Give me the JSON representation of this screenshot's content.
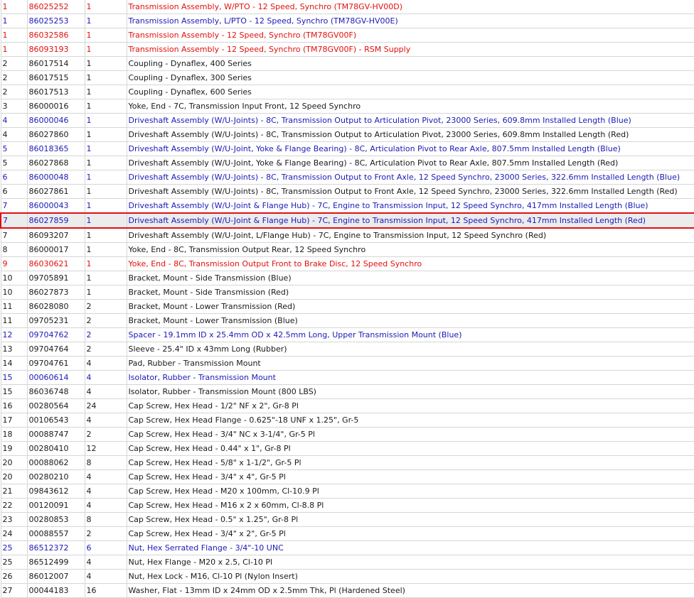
{
  "colors": {
    "red": "#e0100d",
    "blue": "#1a1ab8",
    "black": "#1a1a1a",
    "highlight_border": "#e01014",
    "grid": "#d6d6d6"
  },
  "rows": [
    {
      "item": "1",
      "part": "86025252",
      "qty": "1",
      "desc": "Transmission Assembly, W/PTO - 12 Speed, Synchro (TM78GV-HV00D)",
      "color": "red",
      "highlighted": false
    },
    {
      "item": "1",
      "part": "86025253",
      "qty": "1",
      "desc": "Transmission Assembly, L/PTO - 12 Speed, Synchro (TM78GV-HV00E)",
      "color": "blue",
      "highlighted": false
    },
    {
      "item": "1",
      "part": "86032586",
      "qty": "1",
      "desc": "Transmission Assembly - 12 Speed, Synchro (TM78GV00F)",
      "color": "red",
      "highlighted": false
    },
    {
      "item": "1",
      "part": "86093193",
      "qty": "1",
      "desc": "Transmission Assembly - 12 Speed, Synchro (TM78GV00F) - RSM Supply",
      "color": "red",
      "highlighted": false
    },
    {
      "item": "2",
      "part": "86017514",
      "qty": "1",
      "desc": "Coupling - Dynaflex, 400 Series",
      "color": "black",
      "highlighted": false
    },
    {
      "item": "2",
      "part": "86017515",
      "qty": "1",
      "desc": "Coupling - Dynaflex, 300 Series",
      "color": "black",
      "highlighted": false
    },
    {
      "item": "2",
      "part": "86017513",
      "qty": "1",
      "desc": "Coupling - Dynaflex, 600 Series",
      "color": "black",
      "highlighted": false
    },
    {
      "item": "3",
      "part": "86000016",
      "qty": "1",
      "desc": "Yoke, End - 7C, Transmission Input Front, 12 Speed Synchro",
      "color": "black",
      "highlighted": false
    },
    {
      "item": "4",
      "part": "86000046",
      "qty": "1",
      "desc": "Driveshaft Assembly (W/U-Joints) - 8C, Transmission Output to Articulation Pivot, 23000 Series, 609.8mm Installed Length (Blue)",
      "color": "blue",
      "highlighted": false
    },
    {
      "item": "4",
      "part": "86027860",
      "qty": "1",
      "desc": "Driveshaft Assembly (W/U-Joints) - 8C, Transmission Output to Articulation Pivot, 23000 Series, 609.8mm Installed Length (Red)",
      "color": "black",
      "highlighted": false
    },
    {
      "item": "5",
      "part": "86018365",
      "qty": "1",
      "desc": "Driveshaft Assembly (W/U-Joint, Yoke & Flange Bearing) - 8C, Articulation Pivot to Rear Axle, 807.5mm Installed Length (Blue)",
      "color": "blue",
      "highlighted": false
    },
    {
      "item": "5",
      "part": "86027868",
      "qty": "1",
      "desc": "Driveshaft Assembly (W/U-Joint, Yoke & Flange Bearing) - 8C, Articulation Pivot to Rear Axle, 807.5mm Installed Length (Red)",
      "color": "black",
      "highlighted": false
    },
    {
      "item": "6",
      "part": "86000048",
      "qty": "1",
      "desc": "Driveshaft Assembly (W/U-Joints) - 8C, Transmission Output to Front Axle, 12 Speed Synchro, 23000 Series, 322.6mm Installed Length (Blue)",
      "color": "blue",
      "highlighted": false
    },
    {
      "item": "6",
      "part": "86027861",
      "qty": "1",
      "desc": "Driveshaft Assembly (W/U-Joints) - 8C, Transmission Output to Front Axle, 12 Speed Synchro, 23000 Series, 322.6mm Installed Length (Red)",
      "color": "black",
      "highlighted": false
    },
    {
      "item": "7",
      "part": "86000043",
      "qty": "1",
      "desc": "Driveshaft Assembly (W/U-Joint & Flange Hub) - 7C, Engine to Transmission Input, 12 Speed Synchro, 417mm Installed Length (Blue)",
      "color": "blue",
      "highlighted": false
    },
    {
      "item": "7",
      "part": "86027859",
      "qty": "1",
      "desc": "Driveshaft Assembly (W/U-Joint & Flange Hub) - 7C, Engine to Transmission Input, 12 Speed Synchro, 417mm Installed Length (Red)",
      "color": "blue",
      "highlighted": true
    },
    {
      "item": "7",
      "part": "86093207",
      "qty": "1",
      "desc": "Driveshaft Assembly (W/U-Joint, L/Flange Hub) - 7C, Engine to Transmission Input, 12 Speed Synchro (Red)",
      "color": "black",
      "highlighted": false
    },
    {
      "item": "8",
      "part": "86000017",
      "qty": "1",
      "desc": "Yoke, End - 8C, Transmission Output Rear, 12 Speed Synchro",
      "color": "black",
      "highlighted": false
    },
    {
      "item": "9",
      "part": "86030621",
      "qty": "1",
      "desc": "Yoke, End - 8C, Transmission Output Front to Brake Disc, 12 Speed Synchro",
      "color": "red",
      "highlighted": false
    },
    {
      "item": "10",
      "part": "09705891",
      "qty": "1",
      "desc": "Bracket, Mount - Side Transmission (Blue)",
      "color": "black",
      "highlighted": false
    },
    {
      "item": "10",
      "part": "86027873",
      "qty": "1",
      "desc": "Bracket, Mount - Side Transmission (Red)",
      "color": "black",
      "highlighted": false
    },
    {
      "item": "11",
      "part": "86028080",
      "qty": "2",
      "desc": "Bracket, Mount - Lower Transmission (Red)",
      "color": "black",
      "highlighted": false
    },
    {
      "item": "11",
      "part": "09705231",
      "qty": "2",
      "desc": "Bracket, Mount - Lower Transmission (Blue)",
      "color": "black",
      "highlighted": false
    },
    {
      "item": "12",
      "part": "09704762",
      "qty": "2",
      "desc": "Spacer - 19.1mm ID x 25.4mm OD x 42.5mm Long, Upper Transmission Mount (Blue)",
      "color": "blue",
      "highlighted": false
    },
    {
      "item": "13",
      "part": "09704764",
      "qty": "2",
      "desc": "Sleeve - 25.4\" ID x 43mm Long (Rubber)",
      "color": "black",
      "highlighted": false
    },
    {
      "item": "14",
      "part": "09704761",
      "qty": "4",
      "desc": "Pad, Rubber - Transmission Mount",
      "color": "black",
      "highlighted": false
    },
    {
      "item": "15",
      "part": "00060614",
      "qty": "4",
      "desc": "Isolator, Rubber - Transmission Mount",
      "color": "blue",
      "highlighted": false
    },
    {
      "item": "15",
      "part": "86036748",
      "qty": "4",
      "desc": "Isolator, Rubber - Transmission Mount (800 LBS)",
      "color": "black",
      "highlighted": false
    },
    {
      "item": "16",
      "part": "00280564",
      "qty": "24",
      "desc": "Cap Screw, Hex Head - 1/2\" NF x 2\", Gr-8 Pl",
      "color": "black",
      "highlighted": false
    },
    {
      "item": "17",
      "part": "00106543",
      "qty": "4",
      "desc": "Cap Screw, Hex Head Flange - 0.625\"-18 UNF x 1.25\", Gr-5",
      "color": "black",
      "highlighted": false
    },
    {
      "item": "18",
      "part": "00088747",
      "qty": "2",
      "desc": "Cap Screw, Hex Head - 3/4\" NC x 3-1/4\", Gr-5 Pl",
      "color": "black",
      "highlighted": false
    },
    {
      "item": "19",
      "part": "00280410",
      "qty": "12",
      "desc": "Cap Screw, Hex Head - 0.44\" x 1\", Gr-8 Pl",
      "color": "black",
      "highlighted": false
    },
    {
      "item": "20",
      "part": "00088062",
      "qty": "8",
      "desc": "Cap Screw, Hex Head - 5/8\" x 1-1/2\", Gr-5 Pl",
      "color": "black",
      "highlighted": false
    },
    {
      "item": "20",
      "part": "00280210",
      "qty": "4",
      "desc": "Cap Screw, Hex Head - 3/4\" x 4\", Gr-5 Pl",
      "color": "black",
      "highlighted": false
    },
    {
      "item": "21",
      "part": "09843612",
      "qty": "4",
      "desc": "Cap Screw, Hex Head - M20 x 100mm, Cl-10.9 Pl",
      "color": "black",
      "highlighted": false
    },
    {
      "item": "22",
      "part": "00120091",
      "qty": "4",
      "desc": "Cap Screw, Hex Head - M16 x 2 x 60mm, Cl-8.8 Pl",
      "color": "black",
      "highlighted": false
    },
    {
      "item": "23",
      "part": "00280853",
      "qty": "8",
      "desc": "Cap Screw, Hex Head - 0.5\" x 1.25\", Gr-8 Pl",
      "color": "black",
      "highlighted": false
    },
    {
      "item": "24",
      "part": "00088557",
      "qty": "2",
      "desc": "Cap Screw, Hex Head - 3/4\" x 2\", Gr-5 Pl",
      "color": "black",
      "highlighted": false
    },
    {
      "item": "25",
      "part": "86512372",
      "qty": "6",
      "desc": "Nut, Hex Serrated Flange - 3/4\"-10 UNC",
      "color": "blue",
      "highlighted": false
    },
    {
      "item": "25",
      "part": "86512499",
      "qty": "4",
      "desc": "Nut, Hex Flange - M20 x 2.5, Cl-10 Pl",
      "color": "black",
      "highlighted": false
    },
    {
      "item": "26",
      "part": "86012007",
      "qty": "4",
      "desc": "Nut, Hex Lock - M16, Cl-10 Pl (Nylon Insert)",
      "color": "black",
      "highlighted": false
    },
    {
      "item": "27",
      "part": "00044183",
      "qty": "16",
      "desc": "Washer, Flat - 13mm ID x 24mm OD x 2.5mm Thk, Pl (Hardened Steel)",
      "color": "black",
      "highlighted": false
    }
  ]
}
